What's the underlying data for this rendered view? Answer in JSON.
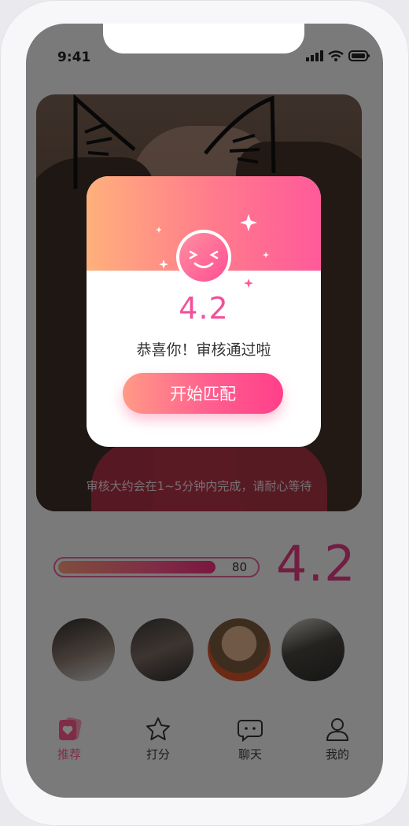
{
  "status_bar": {
    "time": "9:41",
    "icons": [
      "signal-icon",
      "wifi-icon",
      "battery-icon"
    ]
  },
  "photo": {
    "caption": "审核大约会在1~5分钟内完成，请耐心等待"
  },
  "rating": {
    "progress_value": "80",
    "progress_fraction": 0.8,
    "score": "4.2"
  },
  "avatars": [
    "avatar-1",
    "avatar-2",
    "avatar-3",
    "avatar-4"
  ],
  "tabbar": {
    "items": [
      {
        "label": "推荐",
        "icon": "cards-heart-icon",
        "active": true
      },
      {
        "label": "打分",
        "icon": "star-icon",
        "active": false
      },
      {
        "label": "聊天",
        "icon": "chat-bubble-icon",
        "active": false
      },
      {
        "label": "我的",
        "icon": "user-icon",
        "active": false
      }
    ]
  },
  "modal": {
    "score": "4.2",
    "message": "恭喜你！审核通过啦",
    "button_label": "开始匹配"
  },
  "colors": {
    "accent_pink": "#ff5b8c",
    "score_pink": "#e33d84",
    "gradient_start": "#ffb07c",
    "gradient_end": "#ff5a9a"
  }
}
